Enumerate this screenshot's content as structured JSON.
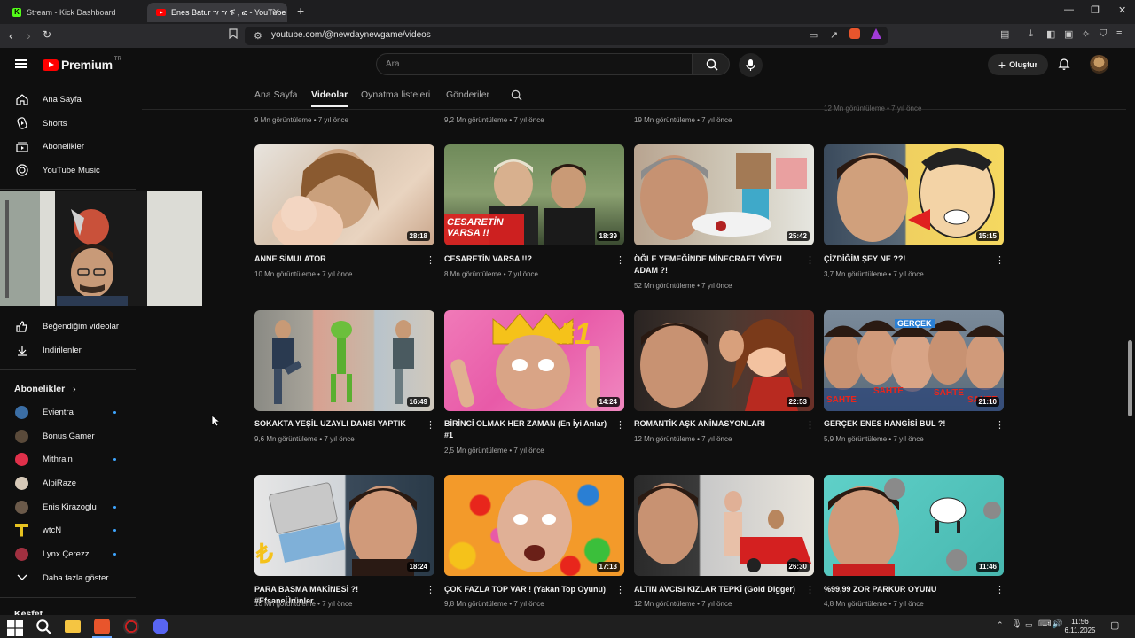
{
  "browser": {
    "tabs": [
      {
        "title": "Stream - Kick Dashboard",
        "active": false
      },
      {
        "title": "Enes Batur ሣ ሣ ፑ , ፎ - YouTube",
        "active": true
      }
    ],
    "url": "youtube.com/@newdaynewgame/videos"
  },
  "header": {
    "logo_text": "Premium",
    "logo_badge": "TR",
    "search_placeholder": "Ara",
    "create_label": "Oluştur"
  },
  "sidebar": {
    "main": [
      {
        "label": "Ana Sayfa",
        "icon": "home-icon"
      },
      {
        "label": "Shorts",
        "icon": "shorts-icon"
      },
      {
        "label": "Abonelikler",
        "icon": "subscriptions-icon"
      },
      {
        "label": "YouTube Music",
        "icon": "music-icon"
      }
    ],
    "library": [
      {
        "label": "Beğendiğim videolar",
        "icon": "thumbs-up-icon"
      },
      {
        "label": "İndirilenler",
        "icon": "download-icon"
      }
    ],
    "subs_title": "Abonelikler",
    "subscriptions": [
      {
        "name": "Evientra",
        "new": true,
        "color": "#3b6ea5"
      },
      {
        "name": "Bonus Gamer",
        "new": false,
        "color": "#5a4a3a"
      },
      {
        "name": "Mithrain",
        "new": true,
        "color": "#e0304a"
      },
      {
        "name": "AlpiRaze",
        "new": false,
        "color": "#d6c9b8"
      },
      {
        "name": "Enis Kirazoglu",
        "new": true,
        "color": "#6b5a4a"
      },
      {
        "name": "wtcN",
        "new": true,
        "color": "#e6c220"
      },
      {
        "name": "Lynx Çerezz",
        "new": true,
        "color": "#a03040"
      }
    ],
    "show_more": "Daha fazla göster",
    "next_section": "Keşfet"
  },
  "channel_tabs": [
    {
      "label": "Ana Sayfa",
      "active": false
    },
    {
      "label": "Videolar",
      "active": true
    },
    {
      "label": "Oynatma listeleri",
      "active": false
    },
    {
      "label": "Gönderiler",
      "active": false
    }
  ],
  "top_row_meta": [
    "9 Mn görüntüleme • 7 yıl önce",
    "9,2 Mn görüntüleme • 7 yıl önce",
    "19 Mn görüntüleme • 7 yıl önce",
    "12 Mn görüntüleme • 7 yıl önce"
  ],
  "videos": [
    {
      "title": "ANNE SİMULATOR",
      "meta": "10 Mn görüntüleme • 7 yıl önce",
      "duration": "28:18"
    },
    {
      "title": "CESARETİN VARSA !!?",
      "meta": "8 Mn görüntüleme • 7 yıl önce",
      "duration": "18:39",
      "overlay": [
        "CESARETİN",
        "VARSA !!"
      ]
    },
    {
      "title": "ÖĞLE YEMEĞİNDE MİNECRAFT YİYEN ADAM ?!",
      "meta": "52 Mn görüntüleme • 7 yıl önce",
      "duration": "25:42"
    },
    {
      "title": "ÇİZDİĞİM ŞEY NE ??!",
      "meta": "3,7 Mn görüntüleme • 7 yıl önce",
      "duration": "15:15"
    },
    {
      "title": "SOKAKTA YEŞİL UZAYLI DANSI YAPTIK",
      "meta": "9,6 Mn görüntüleme • 7 yıl önce",
      "duration": "16:49"
    },
    {
      "title": "BİRİNCİ OLMAK HER ZAMAN (En İyi Anlar) #1",
      "meta": "2,5 Mn görüntüleme • 7 yıl önce",
      "duration": "14:24",
      "overlay": [
        "#1"
      ]
    },
    {
      "title": "ROMANTİK AŞK ANİMASYONLARI",
      "meta": "12 Mn görüntüleme • 7 yıl önce",
      "duration": "22:53"
    },
    {
      "title": "GERÇEK ENES HANGİSİ BUL ?!",
      "meta": "5,9 Mn görüntüleme • 7 yıl önce",
      "duration": "21:10",
      "overlay": [
        "GERÇEK",
        "SAHTE",
        "SAHTE",
        "SAHTE",
        "SAHTE"
      ]
    },
    {
      "title": "PARA BASMA MAKİNESİ ?! #EfsaneÜrünler",
      "meta": "10 Mn görüntüleme • 7 yıl önce",
      "duration": "18:24",
      "overlay": [
        "₺"
      ]
    },
    {
      "title": "ÇOK FAZLA TOP VAR ! (Yakan Top Oyunu)",
      "meta": "9,8 Mn görüntüleme • 7 yıl önce",
      "duration": "17:13"
    },
    {
      "title": "ALTIN AVCISI KIZLAR TEPKİ (Gold Digger)",
      "meta": "12 Mn görüntüleme • 7 yıl önce",
      "duration": "26:30"
    },
    {
      "title": "%99,99 ZOR PARKUR OYUNU",
      "meta": "4,8 Mn görüntüleme • 7 yıl önce",
      "duration": "11:46"
    }
  ],
  "taskbar": {
    "time": "11:56",
    "date": "6.11.2025"
  }
}
